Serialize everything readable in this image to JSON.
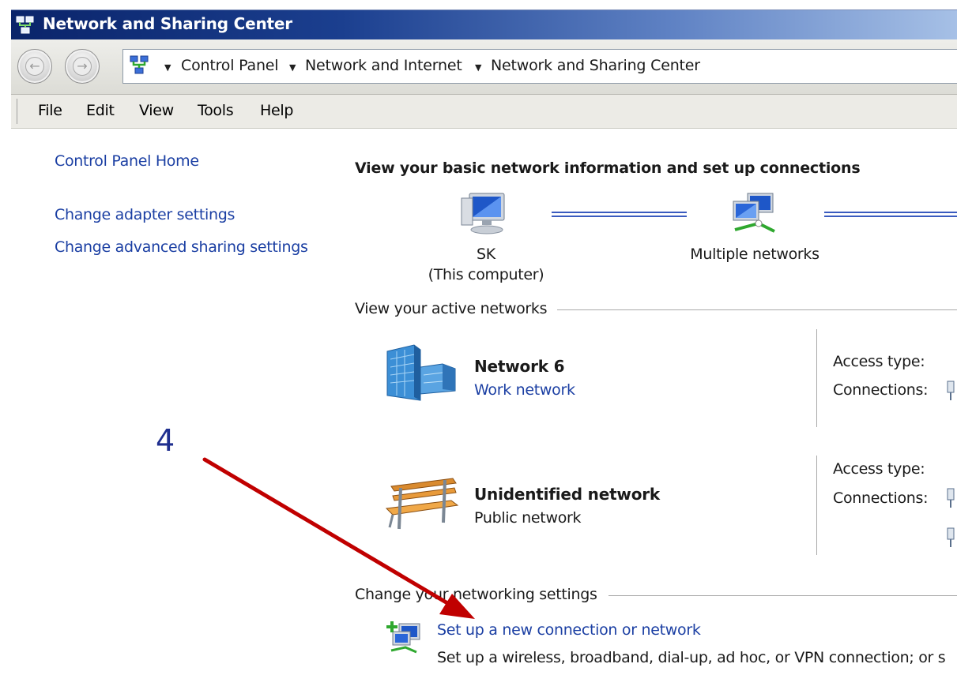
{
  "window": {
    "title": "Network and Sharing Center"
  },
  "address_bar": {
    "breadcrumbs": [
      "Control Panel",
      "Network and Internet",
      "Network and Sharing Center"
    ]
  },
  "menu": [
    "File",
    "Edit",
    "View",
    "Tools",
    "Help"
  ],
  "left_pane": {
    "home": "Control Panel Home",
    "links": [
      "Change adapter settings",
      "Change advanced sharing settings"
    ]
  },
  "main": {
    "heading": "View your basic network information and set up connections",
    "map": {
      "computer_name": "SK",
      "computer_caption": "(This computer)",
      "middle_label": "Multiple networks"
    },
    "active_networks": {
      "title": "View your active networks",
      "networks": [
        {
          "name": "Network  6",
          "type": "Work network",
          "access_label": "Access type:",
          "connections_label": "Connections:",
          "icon": "building-icon"
        },
        {
          "name": "Unidentified network",
          "type": "Public network",
          "access_label": "Access type:",
          "connections_label": "Connections:",
          "icon": "bench-icon"
        }
      ]
    },
    "settings": {
      "title": "Change your networking settings",
      "tasks": [
        {
          "link": "Set up a new connection or network",
          "description": "Set up a wireless, broadband, dial-up, ad hoc, or VPN connection; or s"
        }
      ]
    }
  },
  "annotation": {
    "step_number": "4",
    "arrow_color": "#c00000"
  },
  "colors": {
    "link": "#1b3fa3",
    "titlebar": "#0a246a",
    "map_line": "#3a5bbf"
  }
}
